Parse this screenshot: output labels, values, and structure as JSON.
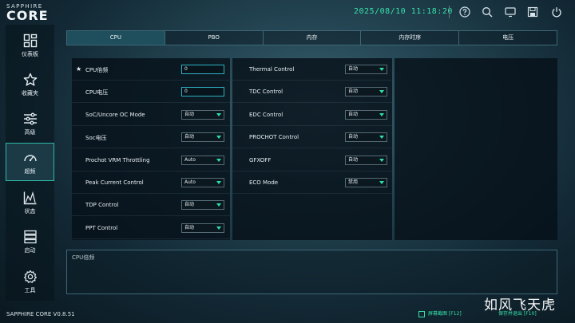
{
  "header": {
    "brand_top": "SAPPHIRE",
    "brand_main": "CORE",
    "datetime": "2025/08/10 11:18:20",
    "icons": [
      "help-icon",
      "search-icon",
      "display-icon",
      "save-icon",
      "power-icon"
    ]
  },
  "sidebar": {
    "items": [
      {
        "label": "仪表板",
        "icon": "dashboard-icon"
      },
      {
        "label": "收藏夹",
        "icon": "star-icon"
      },
      {
        "label": "高级",
        "icon": "sliders-icon"
      },
      {
        "label": "超频",
        "icon": "gauge-icon"
      },
      {
        "label": "状态",
        "icon": "chart-icon"
      },
      {
        "label": "启动",
        "icon": "boot-icon"
      },
      {
        "label": "工具",
        "icon": "gear-icon"
      }
    ],
    "version": "SAPPHIRE CORE V0.8.51"
  },
  "tabs": [
    "CPU",
    "PBO",
    "内存",
    "内存时序",
    "电压"
  ],
  "left_rows": [
    {
      "label": "CPU倍频",
      "value": "0",
      "kind": "input"
    },
    {
      "label": "CPU电压",
      "value": "0",
      "kind": "input"
    },
    {
      "label": "SoC/Uncore OC Mode",
      "value": "自动",
      "kind": "select"
    },
    {
      "label": "Soc电压",
      "value": "自动",
      "kind": "select"
    },
    {
      "label": "Prochot VRM Throttling",
      "value": "Auto",
      "kind": "select"
    },
    {
      "label": "Peak Current Control",
      "value": "Auto",
      "kind": "select"
    },
    {
      "label": "TDP Control",
      "value": "自动",
      "kind": "select"
    },
    {
      "label": "PPT Control",
      "value": "自动",
      "kind": "select"
    }
  ],
  "right_rows": [
    {
      "label": "Thermal Control",
      "value": "自动"
    },
    {
      "label": "TDC Control",
      "value": "自动"
    },
    {
      "label": "EDC Control",
      "value": "自动"
    },
    {
      "label": "PROCHOT Control",
      "value": "自动"
    },
    {
      "label": "GFXOFF",
      "value": "自动"
    },
    {
      "label": "ECO Mode",
      "value": "禁用"
    }
  ],
  "description_title": "CPU倍频",
  "footer": {
    "screenshot": "屏幕截图 [F12]",
    "save_exit": "保存并退出 [F10]"
  },
  "watermark": "如风飞天虎",
  "colors": {
    "accent": "#37e0a8",
    "active_border": "#2fb8a4"
  }
}
